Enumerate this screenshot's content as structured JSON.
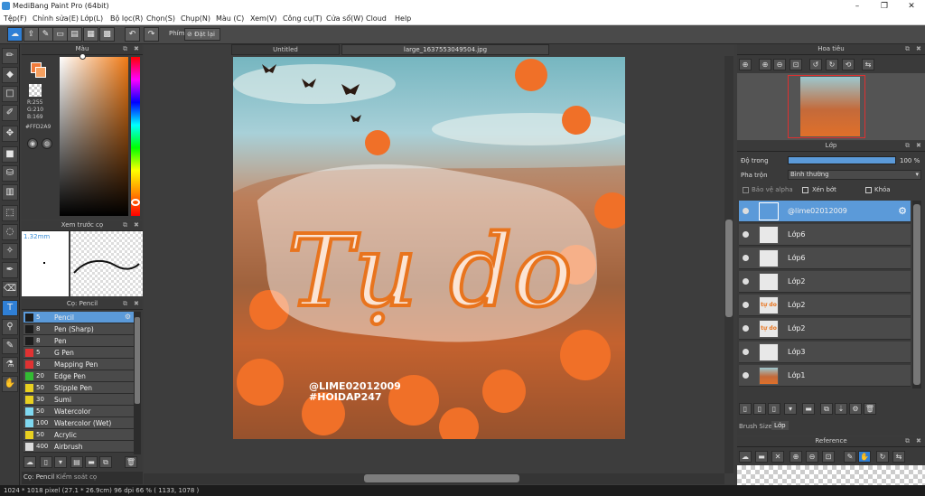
{
  "app": {
    "title": "MediBang Paint Pro (64bit)"
  },
  "menu": [
    "Tệp(F)",
    "Chỉnh sửa(E)",
    "Lớp(L)",
    "Bộ lọc(R)",
    "Chọn(S)",
    "Chụp(N)",
    "Màu (C)",
    "Xem(V)",
    "Công cụ(T)",
    "Cửa sổ(W)",
    "Cloud",
    "Help"
  ],
  "toolbar": {
    "stabilizer_label": "Phím",
    "reset_label": "Đặt lại"
  },
  "color_panel": {
    "title": "Màu",
    "r": "R:255",
    "g": "G:210",
    "b": "B:169",
    "hex": "#FFD2A9",
    "fg": "#f07a3a",
    "bg": "#ffffff"
  },
  "brush_preview": {
    "title": "Xem trước cọ",
    "size": "1.32mm"
  },
  "brush_panel": {
    "title": "Cọ: Pencil",
    "brushes": [
      {
        "size": "5",
        "name": "Pencil",
        "color": "#1c1c1c"
      },
      {
        "size": "8",
        "name": "Pen (Sharp)",
        "color": "#1c1c1c"
      },
      {
        "size": "8",
        "name": "Pen",
        "color": "#1c1c1c"
      },
      {
        "size": "5",
        "name": "G Pen",
        "color": "#e03232"
      },
      {
        "size": "8",
        "name": "Mapping Pen",
        "color": "#e03232"
      },
      {
        "size": "20",
        "name": "Edge Pen",
        "color": "#33bb33"
      },
      {
        "size": "50",
        "name": "Stipple Pen",
        "color": "#e8d020"
      },
      {
        "size": "30",
        "name": "Sumi",
        "color": "#e8d020"
      },
      {
        "size": "50",
        "name": "Watercolor",
        "color": "#7fd8f0"
      },
      {
        "size": "100",
        "name": "Watercolor (Wet)",
        "color": "#7fd8f0"
      },
      {
        "size": "50",
        "name": "Acrylic",
        "color": "#e8d020"
      },
      {
        "size": "400",
        "name": "Airbrush",
        "color": "#dcdcdc"
      }
    ]
  },
  "bottom_tabs": {
    "brush": "Cọ: Pencil",
    "control": "Kiểm soát cọ"
  },
  "documents": {
    "tab1": "Untitled",
    "tab2": "large_1637553049504.jpg"
  },
  "artwork": {
    "title": "Tụ do",
    "tag1": "@LIME02012009",
    "tag2": "#HOIDAP247"
  },
  "status": {
    "text": "1024 * 1018 pixel   (27.1 * 26.9cm)   96 dpi   66 %   ( 1133, 1078 )"
  },
  "navigator": {
    "title": "Hoa tiêu"
  },
  "layers": {
    "title": "Lớp",
    "opacity_label": "Độ trong",
    "opacity_value": "100 %",
    "opacity": 1.0,
    "blend_label": "Pha trộn",
    "blend_value": "Bình thường",
    "protect_alpha": "Bảo vệ alpha",
    "clipping": "Xén bớt",
    "lock": "Khóa",
    "items": [
      {
        "name": "@lime02012009",
        "thumb": ""
      },
      {
        "name": "Lớp6",
        "thumb": ""
      },
      {
        "name": "Lớp6",
        "thumb": ""
      },
      {
        "name": "Lớp2",
        "thumb": ""
      },
      {
        "name": "Lớp2",
        "thumb": "tự do"
      },
      {
        "name": "Lớp2",
        "thumb": "tự do"
      },
      {
        "name": "Lớp3",
        "thumb": ""
      },
      {
        "name": "Lớp1",
        "thumb": ""
      }
    ]
  },
  "right_tabs": {
    "brush_size": "Brush Size",
    "layer": "Lớp"
  },
  "reference": {
    "title": "Reference"
  }
}
